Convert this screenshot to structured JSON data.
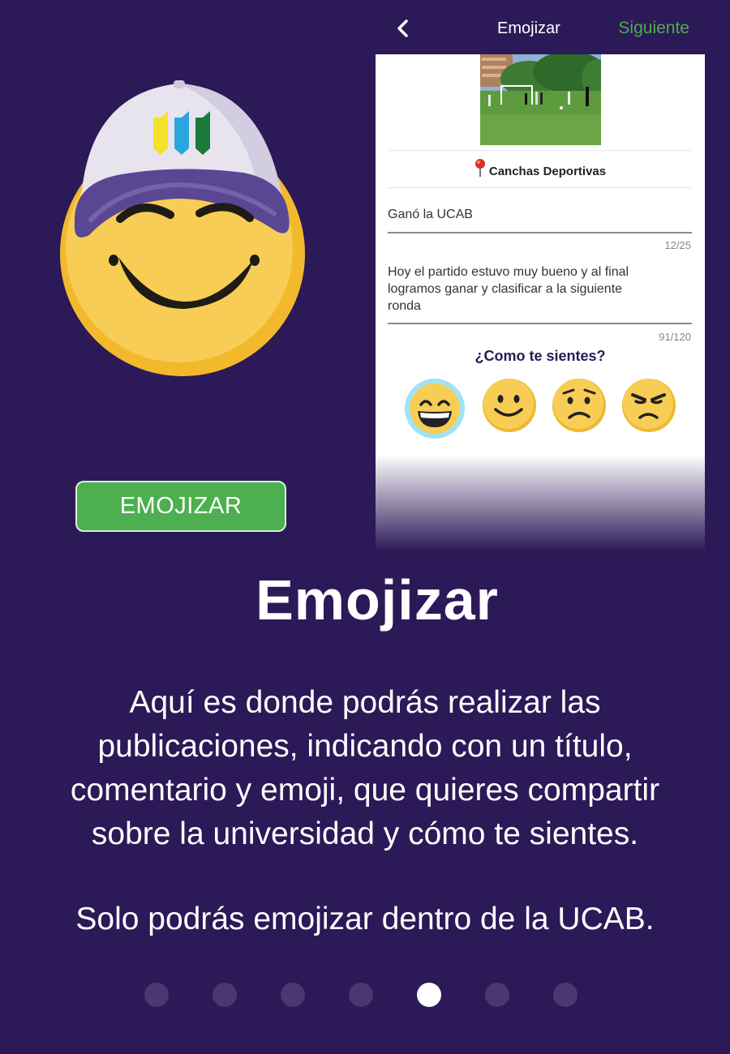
{
  "colors": {
    "background": "#2c1957",
    "accent_green": "#4caf50",
    "emoji_yellow": "#f7c948"
  },
  "mascot": {
    "icon": "smiling-emoji-with-cap-icon"
  },
  "cta_button": {
    "label": "EMOJIZAR"
  },
  "phone": {
    "header": {
      "back_icon": "chevron-left-icon",
      "title": "Emojizar",
      "next_label": "Siguiente"
    },
    "location": "Canchas Deportivas",
    "title_field": {
      "value": "Ganó la UCAB",
      "counter": "12/25"
    },
    "comment_field": {
      "lines": [
        "Hoy el partido estuvo muy bueno y al final",
        "logramos ganar y clasificar a la siguiente",
        "ronda"
      ],
      "counter": "91/120"
    },
    "mood_question": "¿Como te sientes?",
    "moods": [
      {
        "icon": "grinning-face-icon",
        "selected": true
      },
      {
        "icon": "smiling-face-icon",
        "selected": false
      },
      {
        "icon": "worried-face-icon",
        "selected": false
      },
      {
        "icon": "angry-face-icon",
        "selected": false
      }
    ]
  },
  "heading": "Emojizar",
  "description_lines": [
    "Aquí es donde podrás realizar las",
    "publicaciones, indicando con un título,",
    "comentario y emoji, que quieres compartir",
    "sobre la universidad y cómo te sientes."
  ],
  "note": "Solo podrás emojizar dentro de la UCAB.",
  "pagination": {
    "total": 7,
    "active_index": 4
  }
}
